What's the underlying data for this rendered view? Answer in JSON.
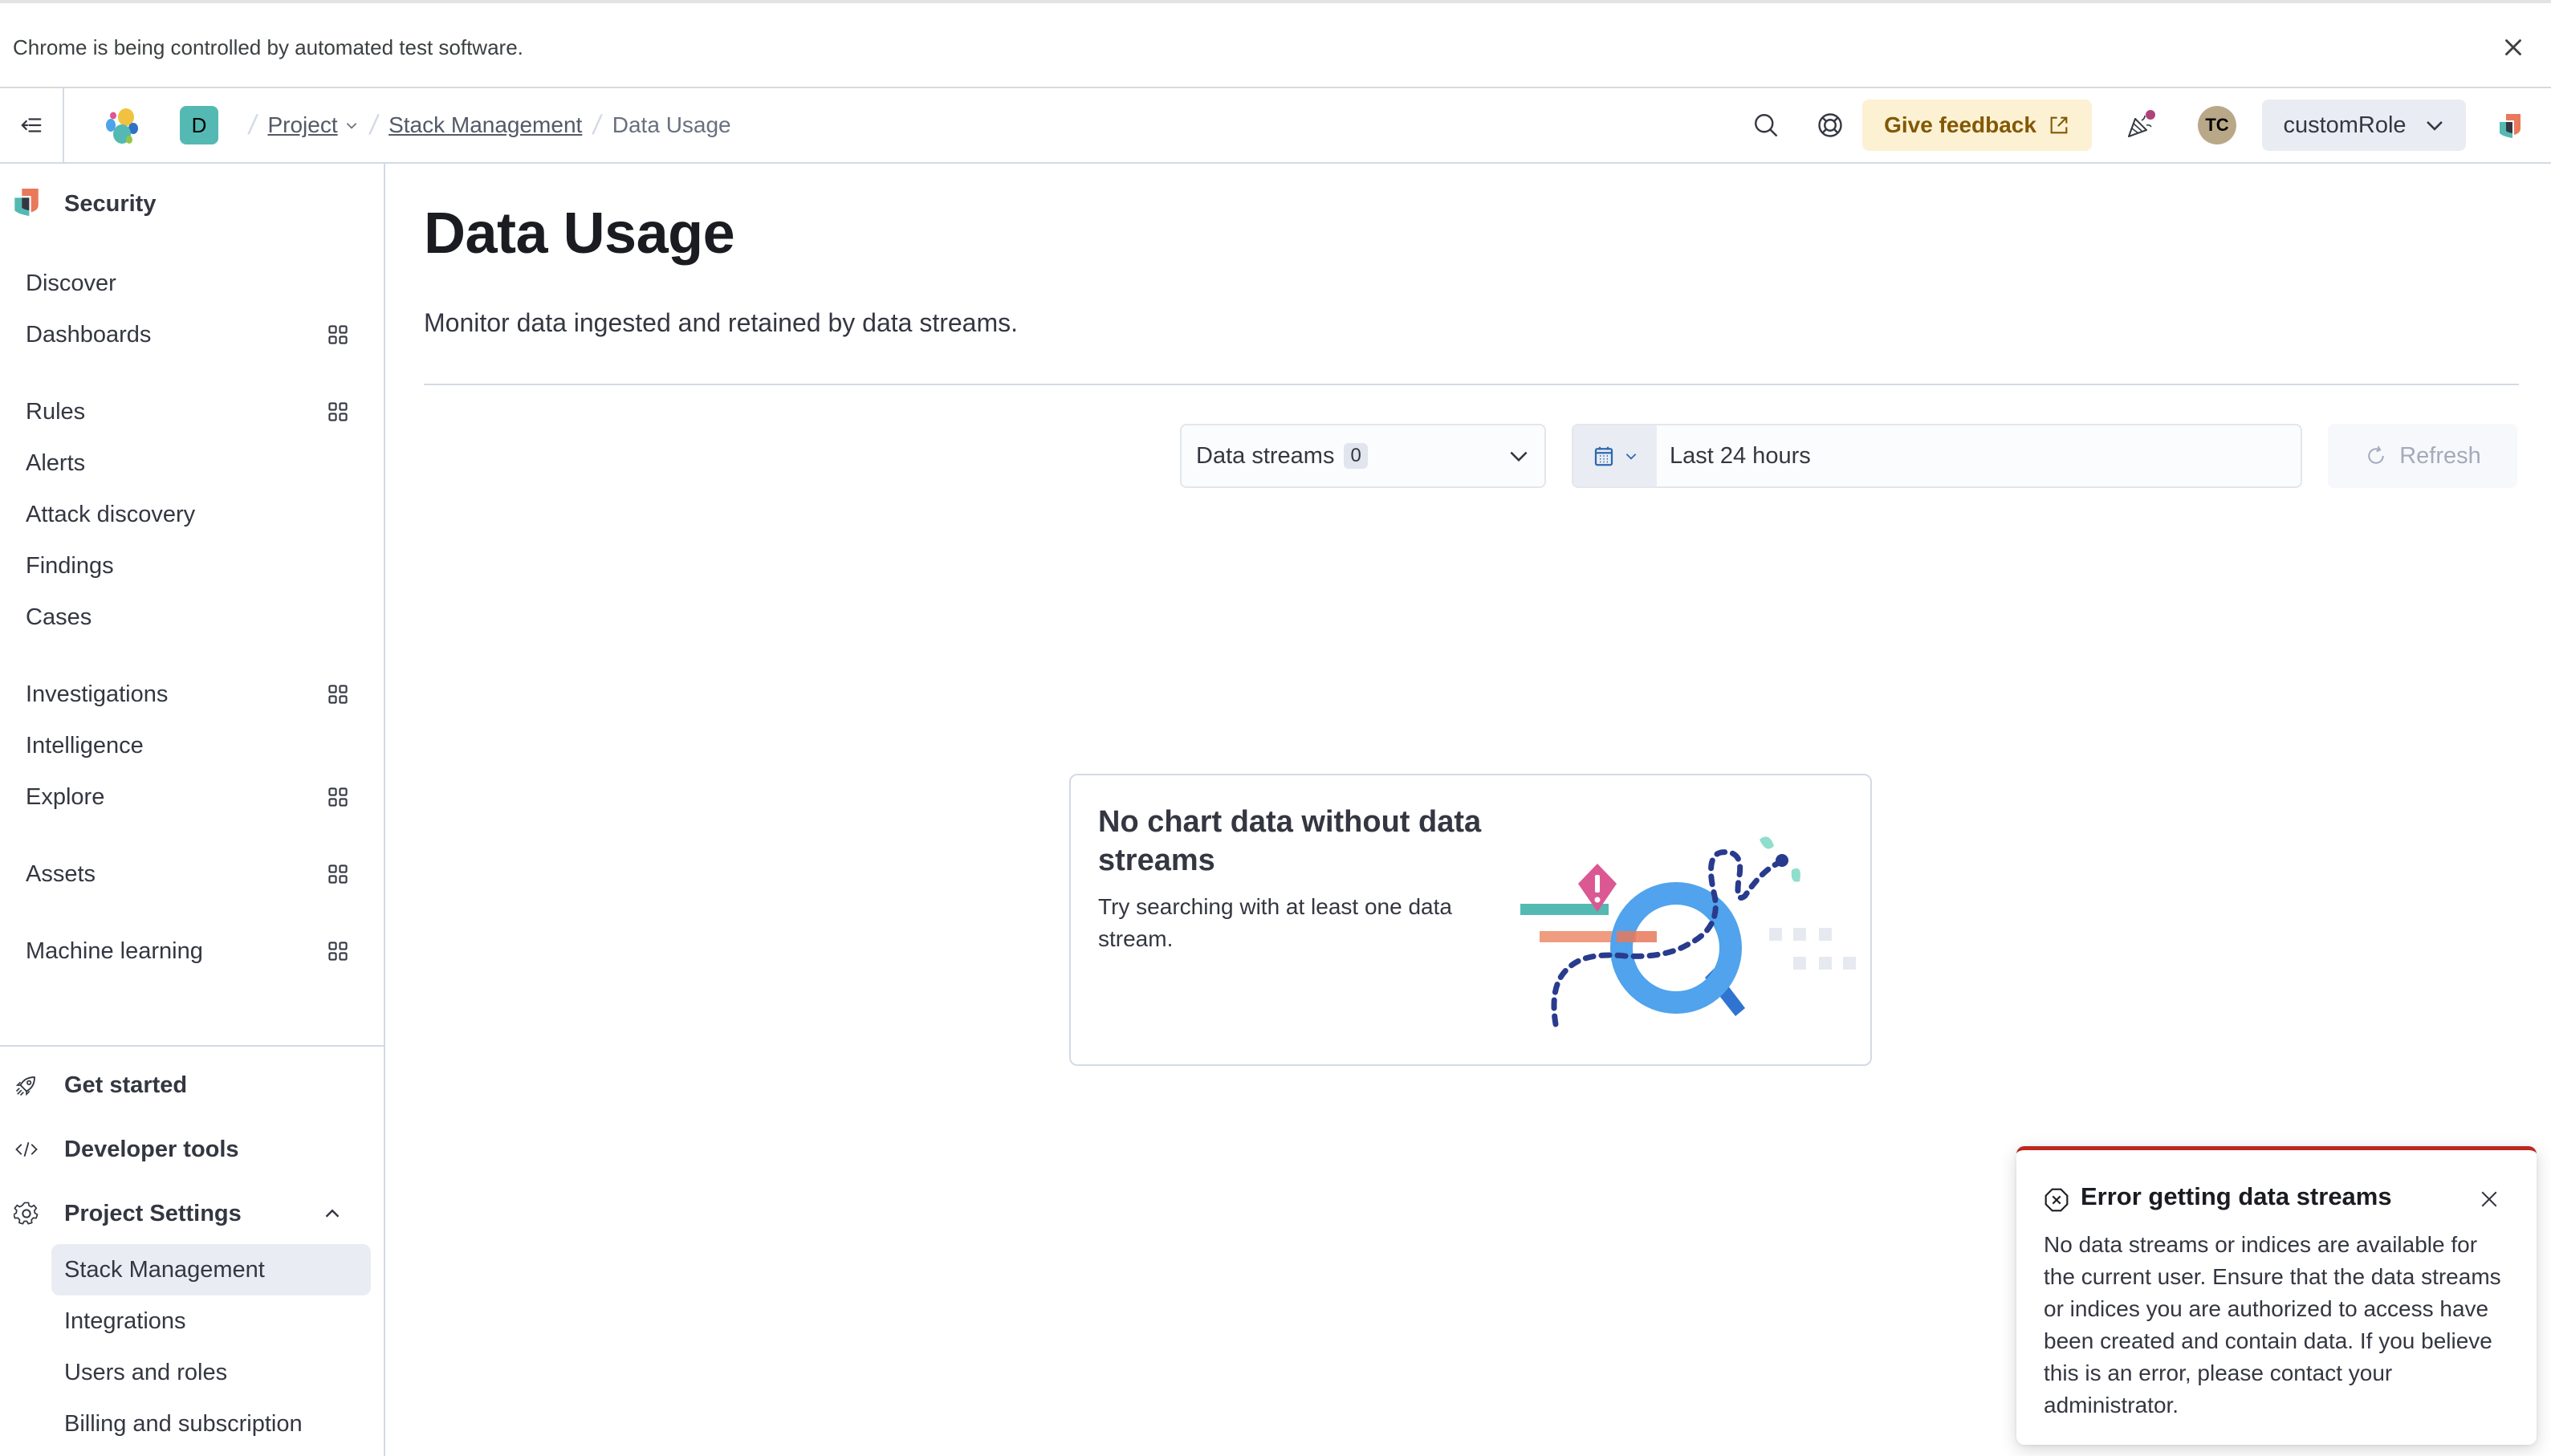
{
  "infobar": {
    "message": "Chrome is being controlled by automated test software."
  },
  "header": {
    "space_initial": "D",
    "breadcrumbs": {
      "project": "Project",
      "stack_management": "Stack Management",
      "current": "Data Usage"
    },
    "feedback_label": "Give feedback",
    "avatar_initials": "TC",
    "role_label": "customRole",
    "colors": {
      "feedback_bg": "#fdf1d4",
      "feedback_text": "#825803",
      "notification_dot": "#b0427a",
      "space_badge": "#54b9b2"
    }
  },
  "sidebar": {
    "solution": "Security",
    "groups": [
      [
        {
          "label": "Discover",
          "panel": false
        },
        {
          "label": "Dashboards",
          "panel": true
        }
      ],
      [
        {
          "label": "Rules",
          "panel": true
        },
        {
          "label": "Alerts",
          "panel": false
        },
        {
          "label": "Attack discovery",
          "panel": false
        },
        {
          "label": "Findings",
          "panel": false
        },
        {
          "label": "Cases",
          "panel": false
        }
      ],
      [
        {
          "label": "Investigations",
          "panel": true
        },
        {
          "label": "Intelligence",
          "panel": false
        },
        {
          "label": "Explore",
          "panel": true
        }
      ],
      [
        {
          "label": "Assets",
          "panel": true
        }
      ],
      [
        {
          "label": "Machine learning",
          "panel": true
        }
      ]
    ],
    "footer": {
      "get_started": "Get started",
      "developer_tools": "Developer tools",
      "project_settings": "Project Settings",
      "project_settings_items": [
        "Stack Management",
        "Integrations",
        "Users and roles",
        "Billing and subscription"
      ],
      "active_item": "Stack Management"
    }
  },
  "main": {
    "title": "Data Usage",
    "description": "Monitor data ingested and retained by data streams.",
    "data_streams_label": "Data streams",
    "data_streams_count": "0",
    "date_range": "Last 24 hours",
    "refresh_label": "Refresh",
    "empty_state": {
      "title": "No chart data without data streams",
      "body": "Try searching with at least one data stream."
    }
  },
  "toast": {
    "title": "Error getting data streams",
    "body": "No data streams or indices are available for the current user. Ensure that the data streams or indices you are authorized to access have been created and contain data. If you believe this is an error, please contact your administrator.",
    "accent_color": "#bd271e"
  }
}
